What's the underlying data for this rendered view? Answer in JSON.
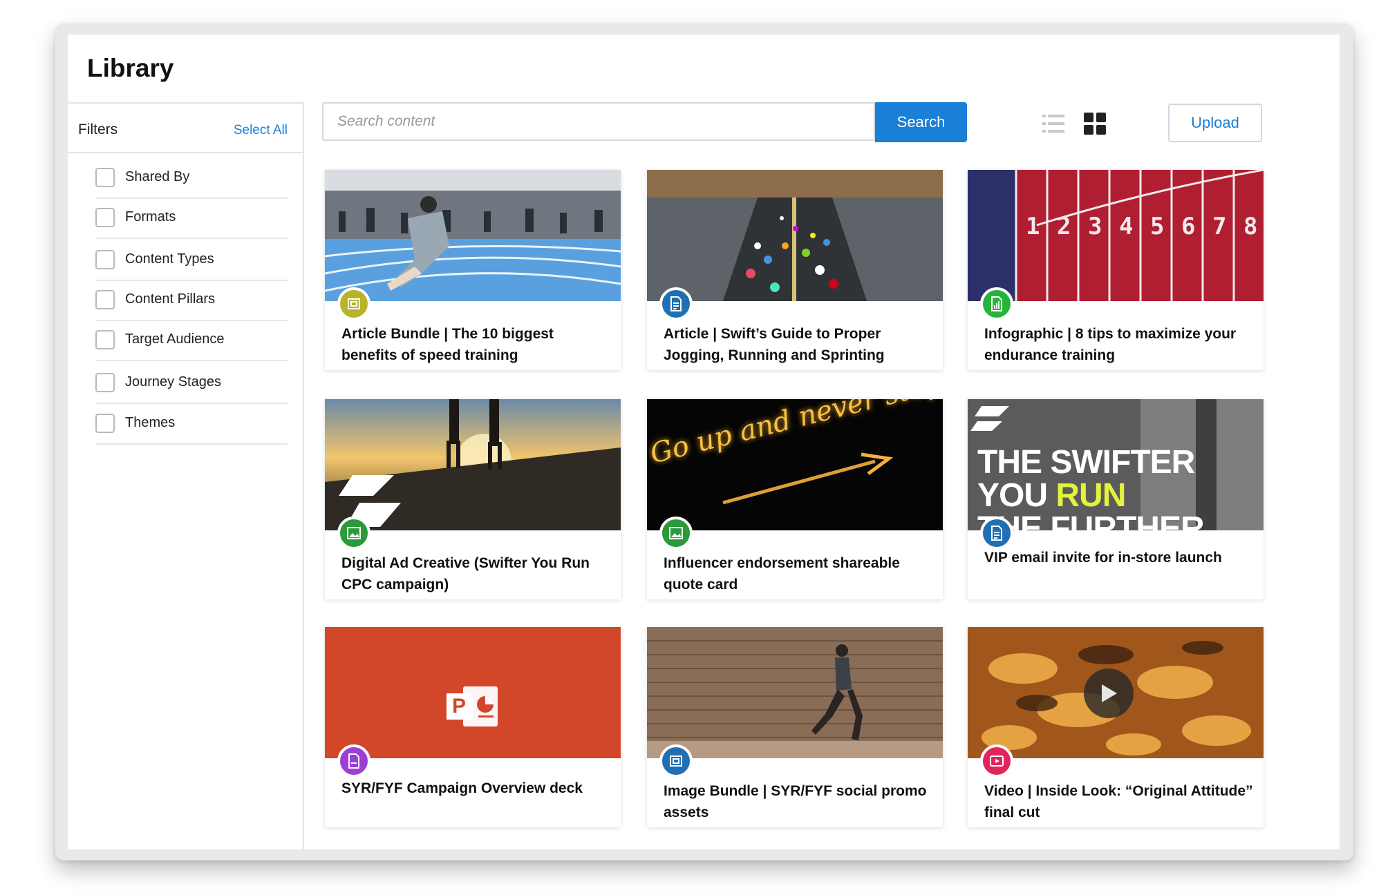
{
  "page": {
    "title": "Library"
  },
  "filters": {
    "label": "Filters",
    "select_all": "Select All",
    "items": [
      {
        "label": "Shared By"
      },
      {
        "label": "Formats"
      },
      {
        "label": "Content Types"
      },
      {
        "label": "Content Pillars"
      },
      {
        "label": "Target Audience"
      },
      {
        "label": "Journey Stages"
      },
      {
        "label": "Themes"
      }
    ]
  },
  "search": {
    "placeholder": "Search content",
    "button_label": "Search"
  },
  "toolbar": {
    "upload_label": "Upload",
    "active_view": "grid"
  },
  "cards": [
    {
      "title": "Article Bundle | The 10 biggest benefits of speed training",
      "type_icon": "bundle-icon",
      "badge_color": "#b7b42a"
    },
    {
      "title": "Article | Swift’s Guide to Proper Jogging, Running and Sprinting",
      "type_icon": "document-icon",
      "badge_color": "#1f6fb2"
    },
    {
      "title": "Infographic | 8 tips to maximize your endurance training",
      "type_icon": "infographic-icon",
      "badge_color": "#27b33a"
    },
    {
      "title": "Digital Ad Creative (Swifter You Run CPC campaign)",
      "type_icon": "image-icon",
      "badge_color": "#2a9a3a"
    },
    {
      "title": "Influencer endorsement shareable quote card",
      "type_icon": "image-icon",
      "badge_color": "#2a9a3a"
    },
    {
      "title": "VIP email invite for in-store launch",
      "type_icon": "document-icon",
      "badge_color": "#1f6fb2"
    },
    {
      "title": "SYR/FYF Campaign Overview deck",
      "type_icon": "presentation-icon",
      "badge_color": "#9b3fd6"
    },
    {
      "title": "Image Bundle | SYR/FYF social promo assets",
      "type_icon": "bundle-icon",
      "badge_color": "#1f6fb2"
    },
    {
      "title": "Video | Inside Look: “Original Attitude” final cut",
      "type_icon": "video-icon",
      "badge_color": "#e0245e"
    }
  ],
  "thumb_text": {
    "lane_numbers": [
      "1",
      "2",
      "3",
      "4",
      "5",
      "6",
      "7",
      "8"
    ],
    "neon_text": "Go up and never stop",
    "poster_line1": "THE SWIFTER",
    "poster_line2a": "YOU",
    "poster_line2b": "RUN",
    "poster_line3": "THE FURTHER",
    "ppt_letter": "P"
  }
}
